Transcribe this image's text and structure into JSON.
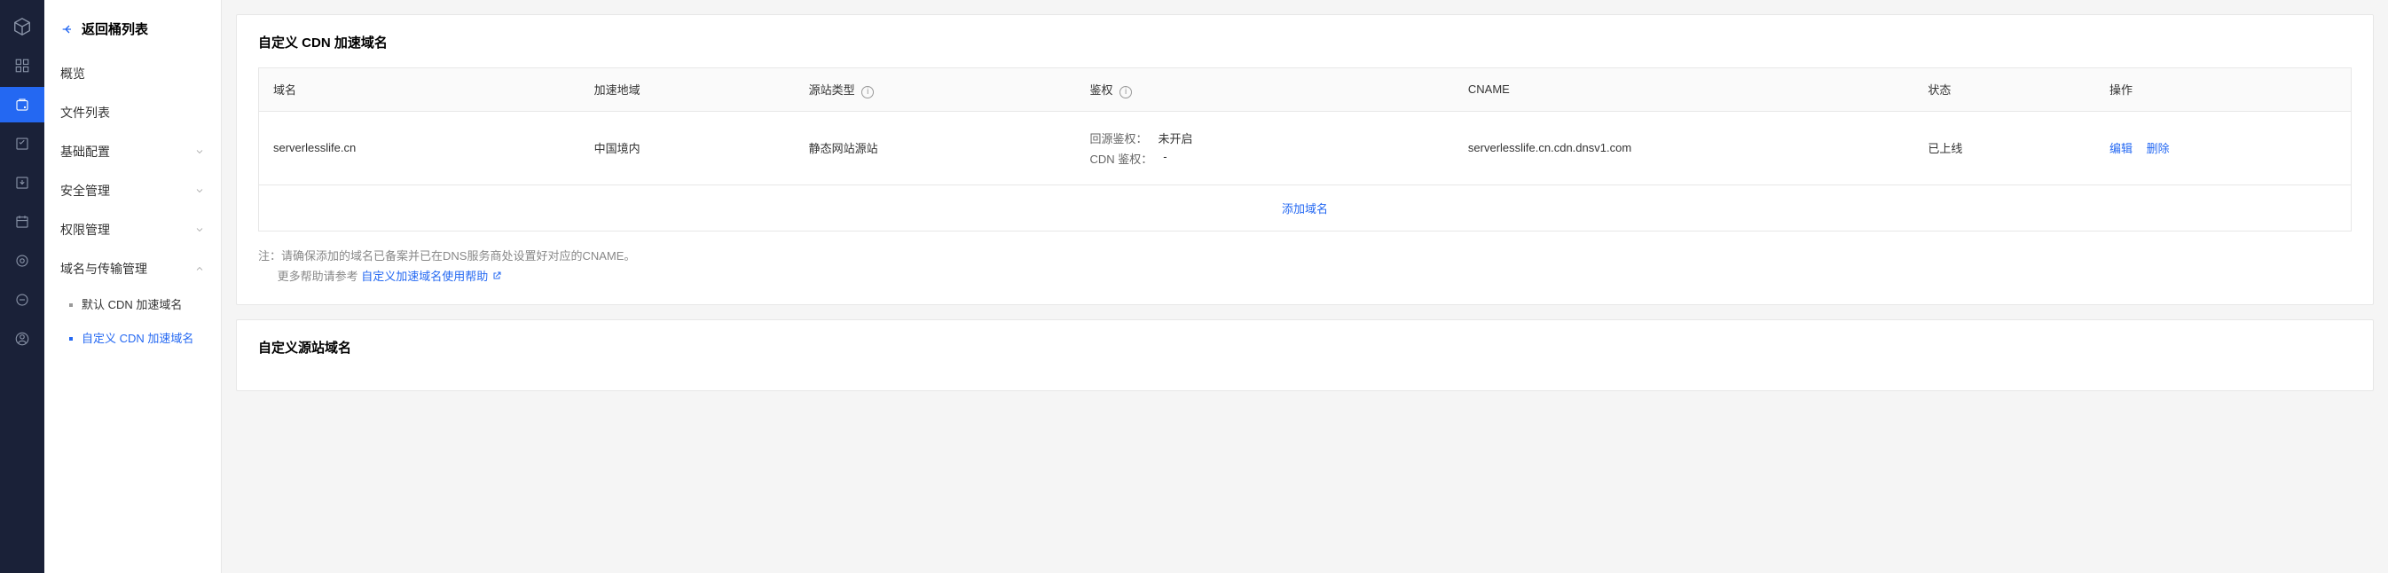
{
  "backLabel": "返回桶列表",
  "sidebar": {
    "overview": "概览",
    "fileList": "文件列表",
    "basicConfig": "基础配置",
    "security": "安全管理",
    "permission": "权限管理",
    "domain": "域名与传输管理",
    "sub": {
      "defaultCdn": "默认 CDN 加速域名",
      "customCdn": "自定义 CDN 加速域名"
    }
  },
  "panel1": {
    "title": "自定义 CDN 加速域名",
    "headers": {
      "domain": "域名",
      "region": "加速地域",
      "originType": "源站类型",
      "auth": "鉴权",
      "cname": "CNAME",
      "status": "状态",
      "action": "操作"
    },
    "row": {
      "domain": "serverlesslife.cn",
      "region": "中国境内",
      "originType": "静态网站源站",
      "authOriginKey": "回源鉴权：",
      "authOriginVal": "未开启",
      "authCdnKey": "CDN 鉴权：",
      "authCdnVal": "-",
      "cname": "serverlesslife.cn.cdn.dnsv1.com",
      "status": "已上线",
      "edit": "编辑",
      "delete": "删除"
    },
    "addDomain": "添加域名",
    "note": {
      "prefix": "注：",
      "line1": "请确保添加的域名已备案并已在DNS服务商处设置好对应的CNAME。",
      "line2a": "更多帮助请参考 ",
      "link": "自定义加速域名使用帮助"
    }
  },
  "panel2": {
    "title": "自定义源站域名"
  }
}
